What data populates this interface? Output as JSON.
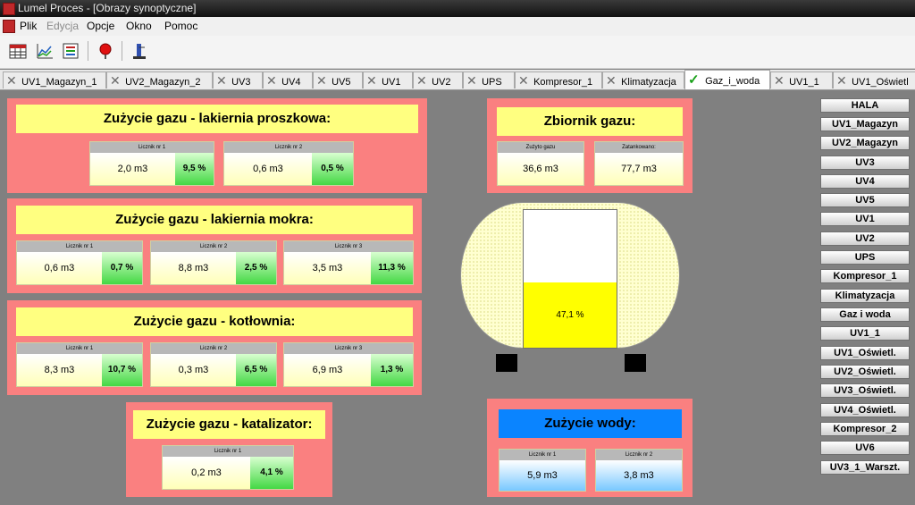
{
  "window": {
    "title": "Lumel Proces - [Obrazy synoptyczne]"
  },
  "menu": [
    {
      "label": "Plik",
      "enabled": true
    },
    {
      "label": "Edycja",
      "enabled": false
    },
    {
      "label": "Opcje",
      "enabled": true
    },
    {
      "label": "Okno",
      "enabled": true
    },
    {
      "label": "Pomoc",
      "enabled": true
    }
  ],
  "toolbar": {
    "icons": [
      "table-icon",
      "chart-icon",
      "list-edit-icon",
      "alarm-icon",
      "trend-icon"
    ]
  },
  "tabs": [
    {
      "label": "UV1_Magazyn_1",
      "active": false
    },
    {
      "label": "UV2_Magazyn_2",
      "active": false
    },
    {
      "label": "UV3",
      "active": false
    },
    {
      "label": "UV4",
      "active": false
    },
    {
      "label": "UV5",
      "active": false
    },
    {
      "label": "UV1",
      "active": false
    },
    {
      "label": "UV2",
      "active": false
    },
    {
      "label": "UPS",
      "active": false
    },
    {
      "label": "Kompresor_1",
      "active": false
    },
    {
      "label": "Klimatyzacja",
      "active": false
    },
    {
      "label": "Gaz_i_woda",
      "active": true
    },
    {
      "label": "UV1_1",
      "active": false
    },
    {
      "label": "UV1_Oświetl",
      "active": false
    }
  ],
  "panels": {
    "proszkowa": {
      "title": "Zużycie gazu - lakiernia proszkowa:",
      "meters": [
        {
          "label": "Licznik nr 1",
          "value": "2,0 m3",
          "pct": "9,5 %"
        },
        {
          "label": "Licznik nr 2",
          "value": "0,6 m3",
          "pct": "0,5 %"
        }
      ]
    },
    "mokra": {
      "title": "Zużycie gazu - lakiernia mokra:",
      "meters": [
        {
          "label": "Licznik nr 1",
          "value": "0,6 m3",
          "pct": "0,7 %"
        },
        {
          "label": "Licznik nr 2",
          "value": "8,8 m3",
          "pct": "2,5 %"
        },
        {
          "label": "Licznik nr 3",
          "value": "3,5 m3",
          "pct": "11,3 %"
        }
      ]
    },
    "kotlownia": {
      "title": "Zużycie gazu - kotłownia:",
      "meters": [
        {
          "label": "Licznik nr 1",
          "value": "8,3 m3",
          "pct": "10,7 %"
        },
        {
          "label": "Licznik nr 2",
          "value": "0,3 m3",
          "pct": "6,5 %"
        },
        {
          "label": "Licznik nr 3",
          "value": "6,9 m3",
          "pct": "1,3 %"
        }
      ]
    },
    "katalizator": {
      "title": "Zużycie gazu - katalizator:",
      "meters": [
        {
          "label": "Licznik nr 1",
          "value": "0,2 m3",
          "pct": "4,1 %"
        }
      ]
    },
    "zbiornik": {
      "title": "Zbiornik gazu:",
      "meters": [
        {
          "label": "Zużyto gazu",
          "value": "36,6 m3"
        },
        {
          "label": "Zatankowano:",
          "value": "77,7 m3"
        }
      ]
    },
    "woda": {
      "title": "Zużycie wody:",
      "meters": [
        {
          "label": "Licznik nr 1",
          "value": "5,9 m3"
        },
        {
          "label": "Licznik nr 2",
          "value": "3,8 m3"
        }
      ]
    }
  },
  "tank": {
    "level_percent": 47.1,
    "level_label": "47,1 %"
  },
  "nav_buttons": [
    "HALA",
    "UV1_Magazyn",
    "UV2_Magazyn",
    "UV3",
    "UV4",
    "UV5",
    "UV1",
    "UV2",
    "UPS",
    "Kompresor_1",
    "Klimatyzacja",
    "Gaz i woda",
    "UV1_1",
    "UV1_Oświetl.",
    "UV2_Oświetl.",
    "UV3_Oświetl.",
    "UV4_Oświetl.",
    "Kompresor_2",
    "UV6",
    "UV3_1_Warszt."
  ]
}
